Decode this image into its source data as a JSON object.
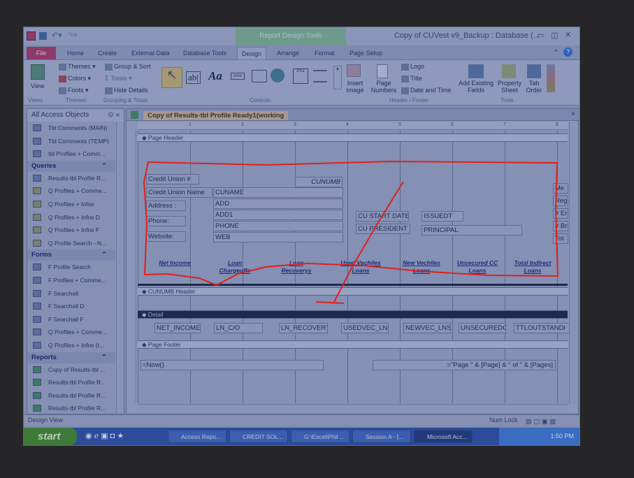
{
  "window": {
    "title": "Copy of CUVest v9_Backup : Database (...",
    "context_tab": "Report Design Tools"
  },
  "tabs": [
    "File",
    "Home",
    "Create",
    "External Data",
    "Database Tools",
    "Design",
    "Arrange",
    "Format",
    "Page Setup"
  ],
  "ribbon": {
    "views": {
      "view": "View",
      "group": "Views"
    },
    "themes": {
      "themes": "Themes",
      "colors": "Colors",
      "fonts": "Fonts",
      "group": "Themes"
    },
    "grouping": {
      "group_sort": "Group & Sort",
      "totals": "Totals",
      "hide_details": "Hide Details",
      "group": "Grouping & Totals"
    },
    "controls": {
      "group": "Controls",
      "textbox": "ab|",
      "label": "Aa",
      "button": "xxxx",
      "xyz": "XYZ"
    },
    "insert_image": "Insert Image",
    "header_footer": {
      "page_numbers": "Page Numbers",
      "logo": "Logo",
      "title": "Title",
      "date_time": "Date and Time",
      "group": "Header / Footer"
    },
    "tools": {
      "add_fields": "Add Existing Fields",
      "property_sheet": "Property Sheet",
      "tab_order": "Tab Order",
      "group": "Tools"
    }
  },
  "nav": {
    "title": "All Access Objects",
    "tables": [
      "Tbl Comments (MAIN)",
      "Tbl Comments (TEMP)",
      "tbl Profiles + Comm..."
    ],
    "sections": [
      {
        "name": "Queries",
        "items": [
          "Results-tbl Profile R...",
          "Q Profiles + Comme...",
          "Q Profiles + Infos",
          "Q Profiles + Infos D",
          "Q Profiles + Infos F",
          "Q Profile Search - N..."
        ]
      },
      {
        "name": "Forms",
        "items": [
          "F Profile Search",
          "F Profiles + Comme...",
          "F Searchall",
          "F Searchall D",
          "F Searchall F",
          "Q Profiles + Comme...",
          "Q Profiles + Infos (t..."
        ]
      },
      {
        "name": "Reports",
        "items": [
          "Copy of Results-tbl ...",
          "Results-tbl Profile R...",
          "Results-tbl Profile R...",
          "Results-tbl Profile R..."
        ]
      }
    ]
  },
  "document": {
    "tab": "Copy of Results-tbl Profile Ready1(working",
    "ruler": [
      "1",
      "2",
      "3",
      "4",
      "5",
      "6",
      "7",
      "8"
    ],
    "sections": {
      "page_header": "Page Header",
      "cunumb_header": "CUNUMB Header",
      "detail": "Detail",
      "page_footer": "Page Footer"
    },
    "header_controls": {
      "cu_num_label": "Credit Union #",
      "cunumb": "CUNUMB",
      "cu_name_label": "Credit Union Name",
      "cuname": "CUNAME",
      "address_label": "Address :",
      "add": "ADD",
      "add1": "ADD1",
      "phone_label": "Phone:",
      "phone": "PHONE",
      "website_label": "Website:",
      "web": "WEB",
      "start_date_label": "CU START DATE",
      "issuedt": "ISSUEDT",
      "president_label": "CU PRESIDENT",
      "principal": "PRINCIPAL",
      "right_cut": [
        "Me",
        "Reg",
        "# Er",
        "# Br",
        "Tot"
      ]
    },
    "column_headers": [
      "Net Income",
      "Loan Chargeoffs",
      "Loan Recoverys",
      "Used Vechiles Loans",
      "New Vechiles Loans",
      "Unsecured CC Loans",
      "Total Indirect Loans"
    ],
    "detail_fields": [
      "NET_INCOME",
      "LN_C/O",
      "LN_RECOVERY",
      "USEDVEC_LNS",
      "NEWVEC_LNS",
      "UNSECUREDCC",
      "TTLOUTSTANDI"
    ],
    "footer": {
      "now": "=Now()",
      "pages": "=\"Page \" & [Page] & \" of \" & [Pages]"
    }
  },
  "status": {
    "left": "Design View",
    "num_lock": "Num Lock"
  },
  "taskbar": {
    "start": "start",
    "items": [
      "Access Repo...",
      "CREDIT SOL...",
      "G:\\Excel\\Phil ...",
      "Session A - [...",
      "Microsoft Acc..."
    ],
    "time": "1:50 PM"
  },
  "colors": {
    "annotation": "#e0201c",
    "file_tab": "#8b3a6a",
    "context_tab": "#6e9a8c"
  }
}
